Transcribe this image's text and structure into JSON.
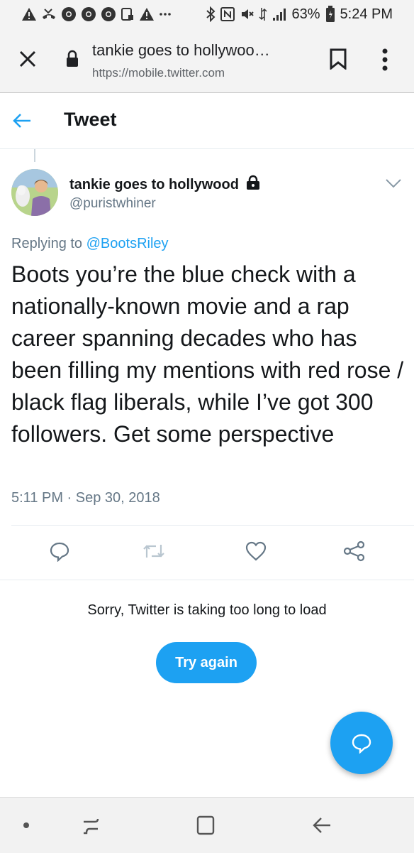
{
  "status_bar": {
    "battery": "63%",
    "time": "5:24 PM",
    "icons": [
      "warning-icon",
      "missed-call-icon",
      "chrome-icon",
      "chrome-icon",
      "chrome-icon",
      "screenshot-icon",
      "warning-icon",
      "more-dots-icon",
      "bluetooth-icon",
      "nfc-icon",
      "mute-icon",
      "data-icon",
      "signal-icon",
      "battery-icon"
    ]
  },
  "browser": {
    "page_title": "tankie goes to hollywoo…",
    "url": "https://mobile.twitter.com",
    "icons": {
      "close": "close-icon",
      "lock": "lock-icon",
      "bookmark": "bookmark-icon",
      "menu": "more-vertical-icon"
    }
  },
  "header": {
    "title": "Tweet",
    "back_icon": "back-arrow-icon"
  },
  "tweet": {
    "author_name": "tankie goes to hollywood",
    "author_handle": "@puristwhiner",
    "replying_prefix": "Replying to",
    "replying_to": "@BootsRiley",
    "text": "Boots you’re the blue check with a nationally-known movie and a rap career spanning decades who has been filling my mentions with red rose / black flag liberals, while I’ve got 300 followers. Get some perspective",
    "timestamp": "5:11 PM · Sep 30, 2018",
    "actions": [
      "reply-icon",
      "retweet-icon",
      "like-icon",
      "share-icon"
    ]
  },
  "error": {
    "message": "Sorry, Twitter is taking too long to load",
    "retry_label": "Try again"
  },
  "colors": {
    "accent": "#1da1f2",
    "text_primary": "#14171a",
    "text_secondary": "#657786",
    "border": "#e6ecf0"
  }
}
